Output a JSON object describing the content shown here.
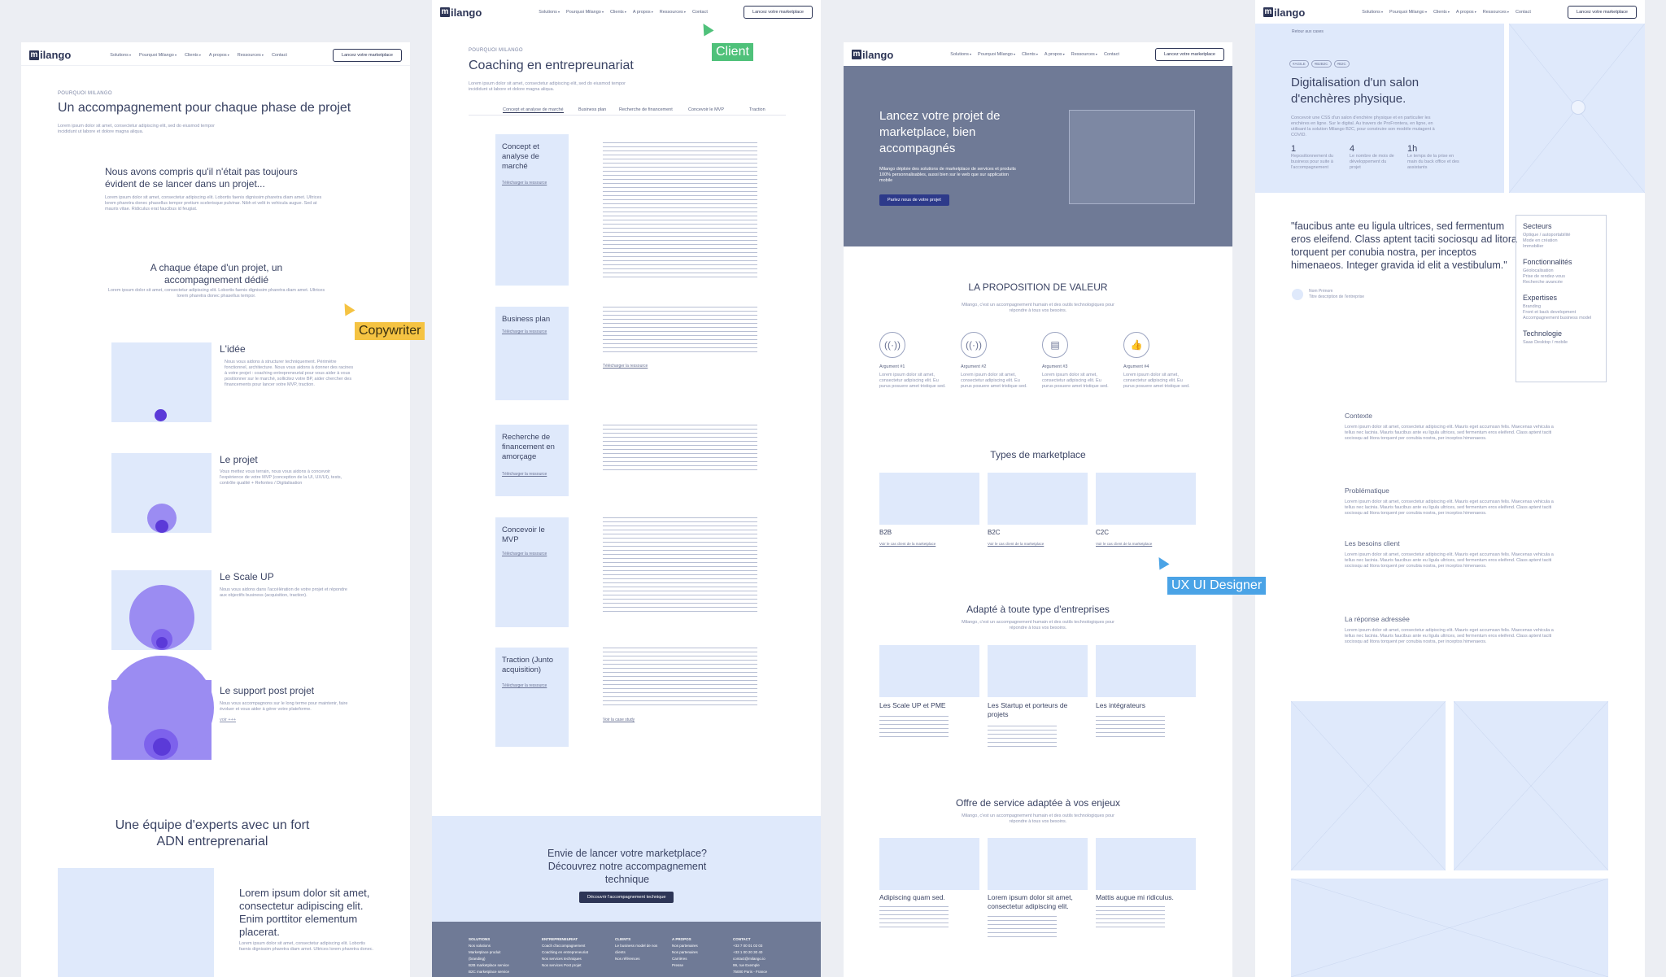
{
  "nav": {
    "logo_mark": "m",
    "logo_text": "ilango",
    "items": [
      "Solutions",
      "Pourquoi Milango",
      "Clients",
      "A propos",
      "Ressources",
      "Contact"
    ],
    "cta": "Lancez votre marketplace"
  },
  "frame1": {
    "kicker": "POURQUOI MILANGO",
    "title": "Un accompagnement pour chaque phase de projet",
    "intro": "Lorem ipsum dolor sit amet, consectetur adipiscing elit, sed do eiusmod tempor incididunt ut labore et dolore magna aliqua.",
    "section1_title": "Nous avons compris qu'il n'était pas toujours évident de se lancer dans un projet...",
    "section1_body": "Lorem ipsum dolor sit amet, consectetur adipiscing elit. Lobortis faenis dignissim pharetra diam amet. Ultrices lorem pharetra donec phasellus tempor pretium scelerisque pulvinar. Nibh et velit in vehicula augue. Sed at mauris vitae. Ridiculus erat faucibus id feugiat.",
    "section2_title": "A chaque étape d'un projet, un accompagnement dédié",
    "section2_body": "Lorem ipsum dolor sit amet, consectetur adipiscing elit. Lobortis faenis dignissim pharetra diam amet. Ultrices lorem pharetra donec phasellus tempor.",
    "steps": [
      {
        "title": "L'idée",
        "text": "Nous vous aidons à structurer techniquement. Périmètre fonctionnel, architecture. Nous vous aidons à donner des racines à votre projet : coaching entrepreneurial pour vous aider à vous positionner sur le marché, sollicitez votre BP, aider chercher des financements pour lancer votre MVP, traction."
      },
      {
        "title": "Le projet",
        "text": "Vous mettez vous terrain, nous vous aidons à concevoir l'expérience de votre MVP (conception de la UI, UX/UI), tests, contrôle qualité + Refontes / Digitalisation"
      },
      {
        "title": "Le Scale UP",
        "text": "Nous vous aidons dans l'accélération de votre projet et répondre aux objectifs business (acquisition, traction)."
      },
      {
        "title": "Le support post projet",
        "text": "Nous vous accompagnons sur le long terme pour maintenir, faire évoluer et vous aider à gérer votre plateforme.",
        "link": "voir +++"
      }
    ],
    "team_title": "Une équipe d'experts avec un fort ADN entreprenarial",
    "team_quote": "Lorem ipsum dolor sit amet, consectetur adipiscing elit. Enim porttitor elementum placerat.",
    "team_body": "Lorem ipsum dolor sit amet, consectetur adipiscing elit. Lobortis faenis dignissim pharetra diam amet. Ultrices lorem pharetra donec."
  },
  "frame2": {
    "kicker": "POURQUOI MILANGO",
    "title": "Coaching en entrepreunariat",
    "intro": "Lorem ipsum dolor sit amet, consectetur adipiscing elit, sed do eiusmod tempor incididunt ut labore et dolore magna aliqua.",
    "tabs": [
      "Concept et analyse de marché",
      "Business plan",
      "Recherche de financement",
      "Concevoir le MVP",
      "Traction"
    ],
    "blocks": [
      {
        "title": "Concept et analyse de marché",
        "link": "Télécharger la ressource"
      },
      {
        "title": "Business plan",
        "link": "Télécharger la ressource"
      },
      {
        "title": "Recherche de financement en amorçage",
        "link": "Télécharger la ressource"
      },
      {
        "title": "Concevoir le MVP",
        "link": "Télécharger la ressource"
      },
      {
        "title": "Traction (Junto acquisition)",
        "link": "Télécharger la ressource"
      }
    ],
    "body_link": "Télécharger la ressource",
    "body_link2": "Voir la case study",
    "banner_title": "Envie de lancer votre marketplace? Découvrez notre accompagnement technique",
    "banner_button": "Découvrir l'accompagnement technique",
    "footer_cols": [
      {
        "title": "SOLUTIONS",
        "items": [
          "Nos solutions",
          "Marketplace produit (branding)",
          "B2B marketplace service",
          "B2C marketplace service"
        ]
      },
      {
        "title": "ENTREPRENEURIAT",
        "items": [
          "Coach d'accompagnement",
          "Coaching en entrepreneuriat",
          "Nos services techniques",
          "Nos services Post projet"
        ]
      },
      {
        "title": "CLIENTS",
        "items": [
          "Le business model de nos clients",
          "Nos références"
        ]
      },
      {
        "title": "A PROPOS",
        "items": [
          "Nos partenaires",
          "Nos partenaires",
          "Carrières",
          "Presse"
        ]
      },
      {
        "title": "CONTACT",
        "items": [
          "+33 7 00 01 02 03",
          "+33 1 00 20 30 40",
          "contact@milango.io",
          "99, rue Exemple",
          "75000 Paris - France"
        ]
      }
    ]
  },
  "frame3": {
    "hero_title": "Lancez votre projet de marketplace, bien accompagnés",
    "hero_body": "Milango déploie des solutions de marketplace de services et produits 100% personnalisables, aussi bien sur le web que sur application mobile",
    "hero_button": "Parlez nous de votre projet",
    "value_title": "LA PROPOSITION DE VALEUR",
    "value_sub": "Milango, c'est un accompagnement humain et des outils technologiques pour répondre à tous vos besoins.",
    "arguments": [
      {
        "label": "Argument #1",
        "icon": "broadcast-icon"
      },
      {
        "label": "Argument #2",
        "icon": "broadcast-icon"
      },
      {
        "label": "Argument #3",
        "icon": "document-icon"
      },
      {
        "label": "Argument #4",
        "icon": "thumbs-up-icon"
      }
    ],
    "arg_text": "Lorem ipsum dolor sit amet, consectetur adipiscing elit. Eu purus posuere amet tristique sed.",
    "types_title": "Types de marketplace",
    "types": [
      {
        "label": "B2B",
        "link": "Voir le cas client de la marketplace"
      },
      {
        "label": "B2C",
        "link": "Voir le cas client de la marketplace"
      },
      {
        "label": "C2C",
        "link": "Voir le cas client de la marketplace"
      }
    ],
    "adapt_title": "Adapté à toute type d'entreprises",
    "adapt_sub": "Milango, c'est un accompagnement humain et des outils technologiques pour répondre à tous vos besoins.",
    "adapt": [
      "Les Scale UP et PME",
      "Les Startup et porteurs de projets",
      "Les intégrateurs"
    ],
    "offer_title": "Offre de service adaptée à vos enjeux",
    "offer_sub": "Milango, c'est un accompagnement humain et des outils technologiques pour répondre à tous vos besoins.",
    "offers": [
      "Adipiscing quam sed.",
      "Lorem ipsum dolor sit amet, consectetur adipiscing elit.",
      "Mattis augue mi ridiculus."
    ]
  },
  "frame4": {
    "breadcrumb": "Retour aux cases",
    "tags": [
      "#AGILE",
      "#B2B2C",
      "#B2C"
    ],
    "title": "Digitalisation d'un salon d'enchères physique.",
    "body": "Concevoir une CSS d'un salon d'enchère physique et en particulier les enchères en ligne. Sur le digital. Au travers de ProFrontera, en ligne, en utilisant la solution Milango B2C, pour construire son modèle mutagent à COVID.",
    "stats": [
      {
        "num": "1",
        "label": "Repositionnement du business pour suite à l'accompagnement"
      },
      {
        "num": "4",
        "label": "Le nombre de mois de développement du projet"
      },
      {
        "num": "1h",
        "label": "Le temps de la prise en main du back office et des assistants"
      }
    ],
    "quote": "\"faucibus ante eu ligula ultrices, sed fermentum eros eleifend. Class aptent taciti sociosqu ad litora torquent per conubia nostra, per inceptos himenaeos. Integer gravida id elit a vestibulum.\"",
    "author_name": "Nom Prénom",
    "author_role": "Titre description de l'entreprise",
    "side_sections": [
      {
        "title": "Secteurs",
        "items": [
          "Optique / autoportabilité",
          "Mode en création",
          "Immobilier"
        ]
      },
      {
        "title": "Fonctionnalités",
        "items": [
          "Géolocalisation",
          "Prise de rendez-vous",
          "Recherche avancée"
        ]
      },
      {
        "title": "Expertises",
        "items": [
          "Branding",
          "Front et back development",
          "Accompagnement business model"
        ]
      },
      {
        "title": "Technologie",
        "items": [
          "Saas Desktop / mobile"
        ]
      }
    ],
    "sections": [
      "Contexte",
      "Problématique",
      "Les besoins client",
      "La réponse adressée"
    ],
    "section_body": "Lorem ipsum dolor sit amet, consectetur adipiscing elit. Mauris eget accumsan felis. Maecenas vehicula a tellus nec lacinia. Mauris faucibus ante eu ligula ultrices, sed fermentum eros eleifend. Class aptent taciti sociosqu ad litora torquent per conubia nostra, per inceptos himenaeos."
  },
  "labels": {
    "copywriter": "Copywriter",
    "client": "Client",
    "ux": "UX UI Designer"
  },
  "colors": {
    "copywriter": "#f5c342",
    "client": "#4fc17a",
    "ux": "#4aa3e6",
    "accent": "#5b3ad8",
    "hero": "#6f7a96"
  }
}
